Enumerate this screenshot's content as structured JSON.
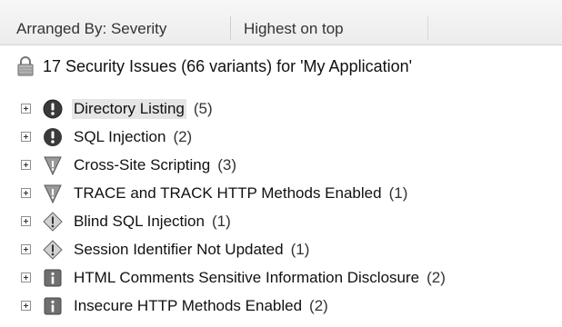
{
  "header": {
    "arranged_by": "Arranged By: Severity",
    "order": "Highest on top"
  },
  "summary": {
    "icon": "lock-icon",
    "text": "17 Security Issues (66 variants) for 'My Application'"
  },
  "issues": [
    {
      "label": "Directory Listing",
      "count": "(5)",
      "severity": "high",
      "icon": "high-severity-icon",
      "selected": true
    },
    {
      "label": "SQL Injection",
      "count": "(2)",
      "severity": "high",
      "icon": "high-severity-icon"
    },
    {
      "label": "Cross-Site Scripting",
      "count": "(3)",
      "severity": "medium",
      "icon": "medium-severity-icon"
    },
    {
      "label": "TRACE and TRACK HTTP Methods Enabled",
      "count": "(1)",
      "severity": "medium",
      "icon": "medium-severity-icon"
    },
    {
      "label": "Blind SQL Injection",
      "count": "(1)",
      "severity": "low",
      "icon": "low-severity-icon"
    },
    {
      "label": "Session Identifier Not Updated",
      "count": "(1)",
      "severity": "low",
      "icon": "low-severity-icon"
    },
    {
      "label": "HTML Comments Sensitive Information Disclosure",
      "count": "(2)",
      "severity": "info",
      "icon": "info-severity-icon"
    },
    {
      "label": "Insecure HTTP Methods Enabled",
      "count": "(2)",
      "severity": "info",
      "icon": "info-severity-icon"
    }
  ],
  "colors": {
    "high": "#3a3a3a",
    "medium": "#9a9a9a",
    "low": "#c8c8c8",
    "info": "#6f6f6f"
  }
}
